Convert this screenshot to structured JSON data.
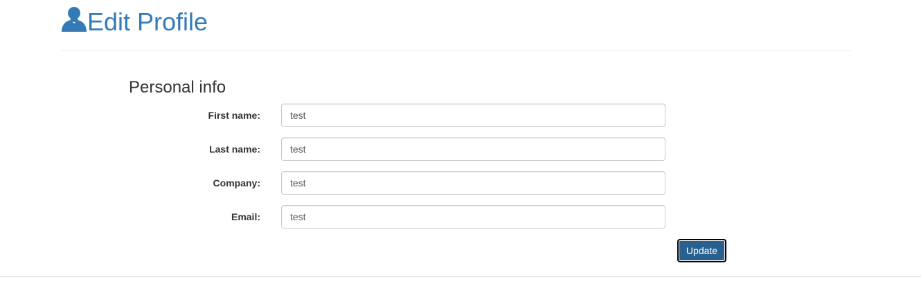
{
  "header": {
    "icon": "user-icon",
    "title": "Edit Profile",
    "accent_color": "#337ab7"
  },
  "section": {
    "heading": "Personal info"
  },
  "form": {
    "fields": [
      {
        "label": "First name:",
        "value": "test"
      },
      {
        "label": "Last name:",
        "value": "test"
      },
      {
        "label": "Company:",
        "value": "test"
      },
      {
        "label": "Email:",
        "value": "test"
      }
    ],
    "submit_label": "Update",
    "submit_color": "#286090"
  }
}
